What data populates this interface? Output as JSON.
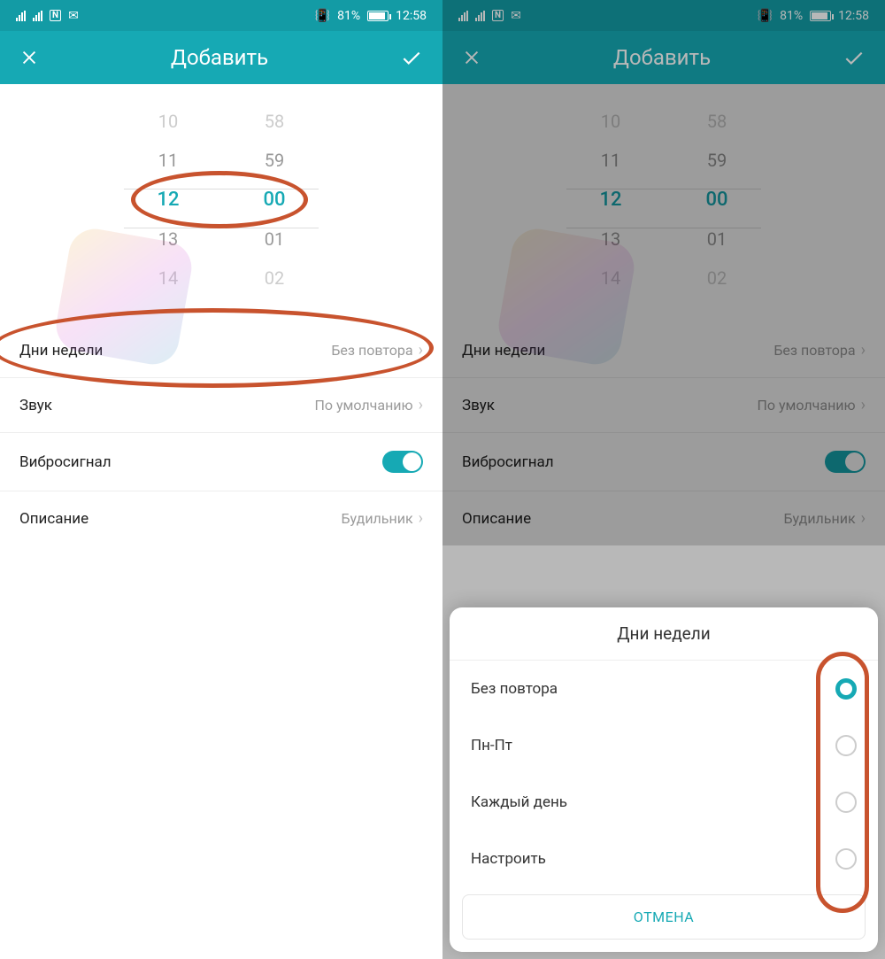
{
  "status": {
    "battery": "81%",
    "time": "12:58",
    "nfc": "N",
    "mail": "✉",
    "vibrate": "📳"
  },
  "header": {
    "title": "Добавить"
  },
  "picker": {
    "hours": [
      "10",
      "11",
      "12",
      "13",
      "14"
    ],
    "mins": [
      "58",
      "59",
      "00",
      "01",
      "02"
    ],
    "selHour": "12",
    "selMin": "00"
  },
  "rows": {
    "days": {
      "label": "Дни недели",
      "value": "Без повтора"
    },
    "sound": {
      "label": "Звук",
      "value": "По умолчанию"
    },
    "vibrate": {
      "label": "Вибросигнал"
    },
    "desc": {
      "label": "Описание",
      "value": "Будильник"
    }
  },
  "sheet": {
    "title": "Дни недели",
    "options": [
      "Без повтора",
      "Пн-Пт",
      "Каждый день",
      "Настроить"
    ],
    "selectedIndex": 0,
    "cancel": "ОТМЕНА"
  },
  "colors": {
    "accent": "#16a9b4",
    "annot": "#c8532e"
  }
}
